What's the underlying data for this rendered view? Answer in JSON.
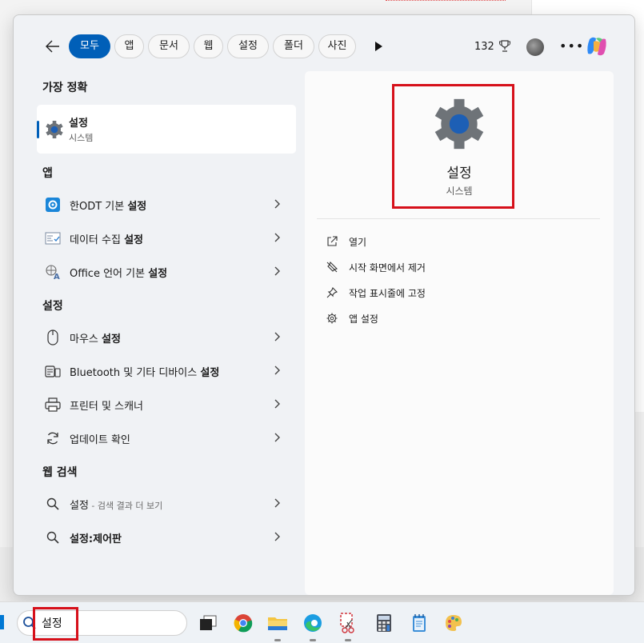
{
  "filters": {
    "tabs": [
      "모두",
      "앱",
      "문서",
      "웹",
      "설정",
      "폴더",
      "사진"
    ],
    "active": "모두",
    "points": "132"
  },
  "best_match": {
    "section": "가장 정확",
    "title": "설정",
    "subtitle": "시스템"
  },
  "apps": {
    "section": "앱",
    "items": [
      {
        "prefix": "한ODT 기본 ",
        "match": "설정"
      },
      {
        "prefix": "데이터 수집 ",
        "match": "설정"
      },
      {
        "prefix": "Office 언어 기본 ",
        "match": "설정"
      }
    ]
  },
  "settings": {
    "section": "설정",
    "items": [
      {
        "prefix": "마우스 ",
        "match": "설정"
      },
      {
        "prefix": "Bluetooth 및 기타 디바이스 ",
        "match": "설정"
      },
      {
        "prefix": "프린터 및 스캐너",
        "match": ""
      },
      {
        "prefix": "업데이트 확인",
        "match": ""
      }
    ]
  },
  "web": {
    "section": "웹 검색",
    "items": [
      {
        "main": "설정",
        "sub": " - 검색 결과 더 보기"
      },
      {
        "main": "설정:제어판",
        "sub": ""
      }
    ]
  },
  "detail": {
    "title": "설정",
    "subtitle": "시스템",
    "actions": [
      "열기",
      "시작 화면에서 제거",
      "작업 표시줄에 고정",
      "앱 설정"
    ]
  },
  "taskbar": {
    "search_value": "설정"
  },
  "colors": {
    "accent": "#005fb8",
    "highlight_box": "#d6101a"
  }
}
